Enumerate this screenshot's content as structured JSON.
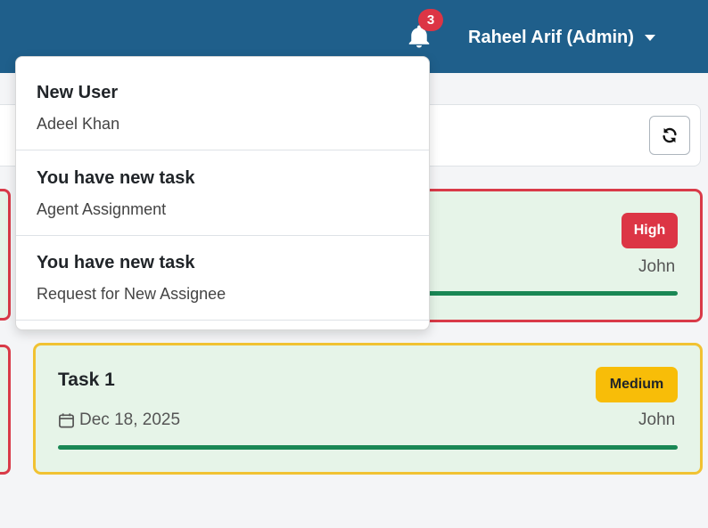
{
  "header": {
    "notifications_count": "3",
    "user_label": "Raheel Arif (Admin)"
  },
  "notifications": [
    {
      "title": "New User",
      "subtitle": "Adeel Khan"
    },
    {
      "title": "You have new task",
      "subtitle": "Agent Assignment"
    },
    {
      "title": "You have new task",
      "subtitle": "Request for New Assignee"
    }
  ],
  "tasks": [
    {
      "priority": "High",
      "assignee": "John",
      "priority_color": "#dc3545",
      "border_color": "#d93a48"
    },
    {
      "title": "Task 1",
      "date": "Dec 18, 2025",
      "priority": "Medium",
      "assignee": "John",
      "priority_color": "#f8bd08",
      "border_color": "#f1c232"
    }
  ],
  "colors": {
    "navbar": "#1f5f8b",
    "card_bg": "#e6f4e8",
    "progress": "#198754"
  },
  "icons": {
    "bell": "bell-icon",
    "refresh": "refresh-icon",
    "calendar": "calendar-icon",
    "caret": "caret-down-icon"
  }
}
